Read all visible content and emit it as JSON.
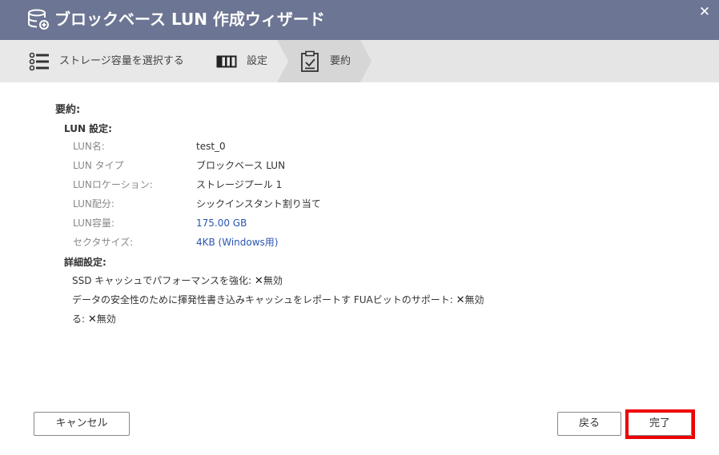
{
  "window": {
    "title": "ブロックベース LUN 作成ウィザード",
    "close_glyph": "✕"
  },
  "steps": [
    {
      "label": "ストレージ容量を選択する",
      "icon": "list-icon"
    },
    {
      "label": "設定",
      "icon": "columns-icon"
    },
    {
      "label": "要約",
      "icon": "clipboard-check-icon"
    }
  ],
  "summary": {
    "heading": "要約:",
    "lun_section": "LUN 設定:",
    "rows": [
      {
        "label": "LUN名:",
        "value": "test_0"
      },
      {
        "label": "LUN タイプ",
        "value": "ブロックベース LUN"
      },
      {
        "label": "LUNロケーション:",
        "value": "ストレージプール 1"
      },
      {
        "label": "LUN配分:",
        "value": "シックインスタント割り当て"
      },
      {
        "label": "LUN容量:",
        "value": "175.00 GB"
      },
      {
        "label": "セクタサイズ:",
        "value": "4KB (Windows用)"
      }
    ],
    "advanced_section": "詳細設定:",
    "advanced_lines": [
      {
        "text": "SSD キャッシュでパフォーマンスを強化:",
        "mark": "✕",
        "status": "無効"
      },
      {
        "text": "データの安全性のために揮発性書き込みキャッシュをレポートす FUAビットのサポート:",
        "mark": "✕",
        "status": "無効"
      },
      {
        "text": "る:",
        "mark": "✕",
        "status": "無効"
      }
    ]
  },
  "buttons": {
    "cancel": "キャンセル",
    "back": "戻る",
    "finish": "完了"
  },
  "colors": {
    "titlebar": "#6c7593",
    "stepbar": "#e5e5e5",
    "link": "#2a55b0",
    "highlight": "#ee0000"
  }
}
